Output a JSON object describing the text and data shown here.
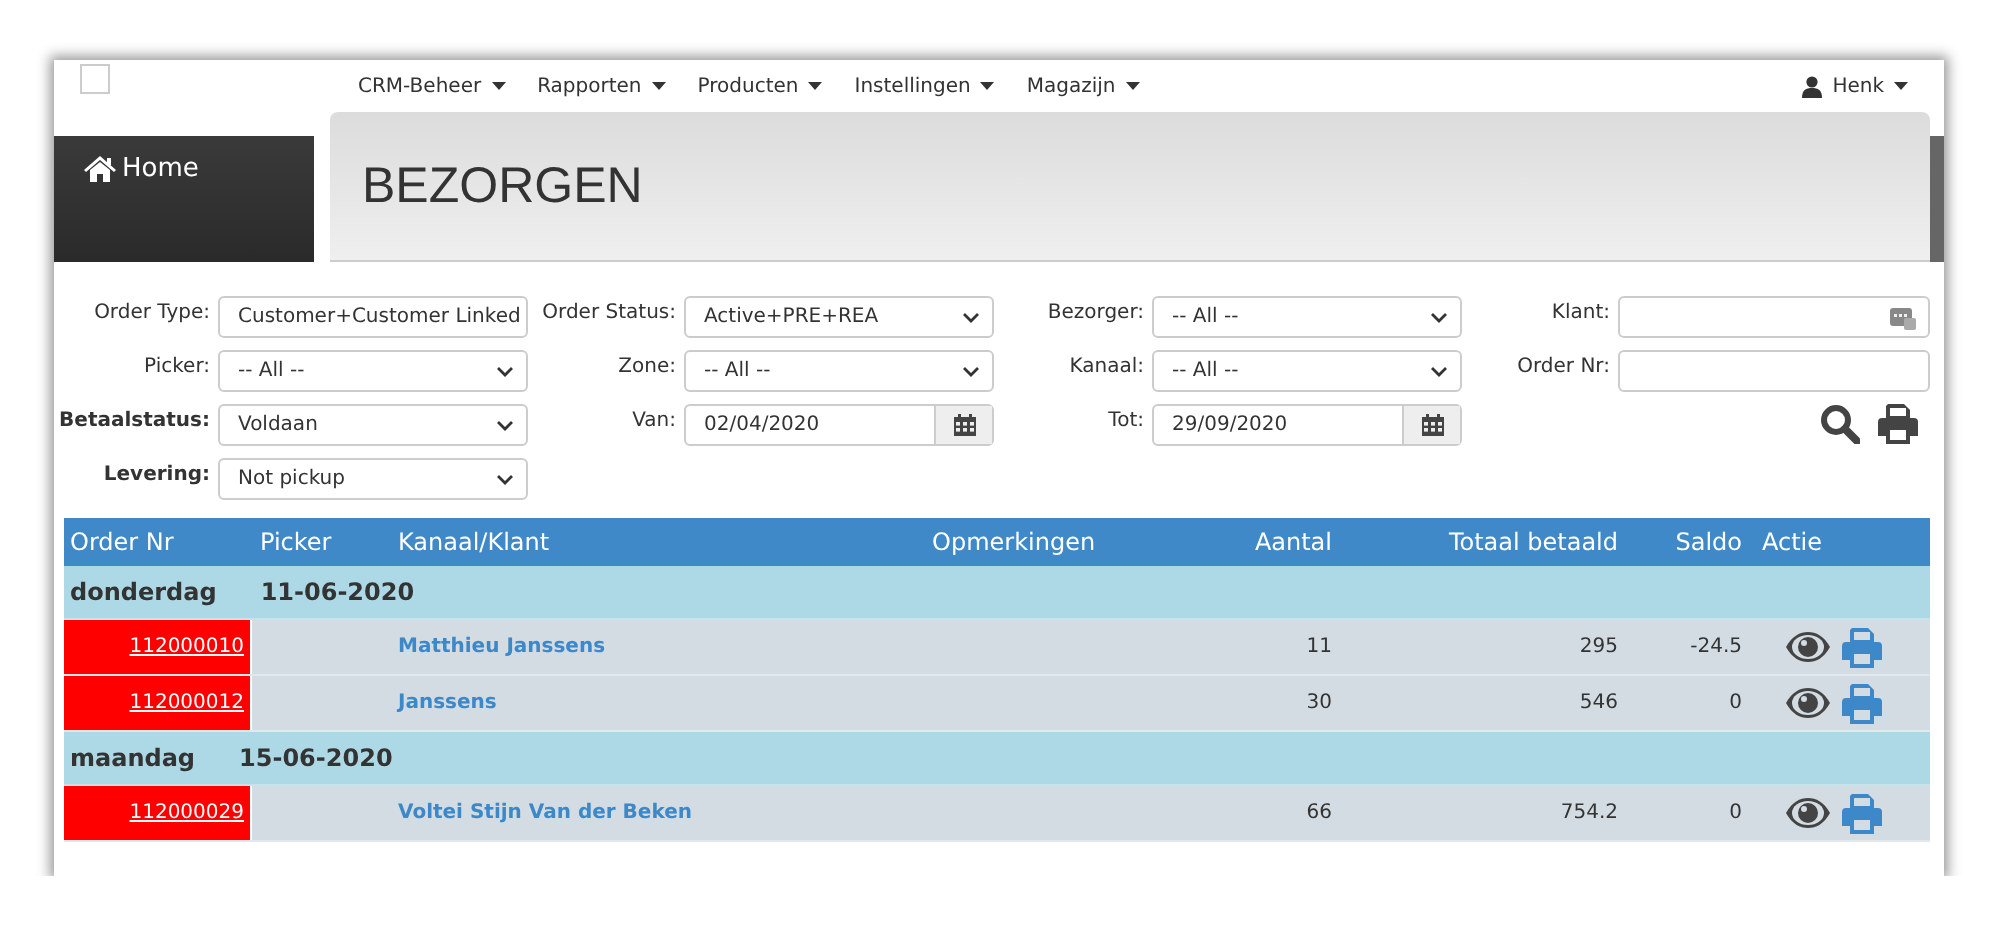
{
  "navbar": {
    "menus": [
      {
        "label": "CRM-Beheer"
      },
      {
        "label": "Rapporten"
      },
      {
        "label": "Producten"
      },
      {
        "label": "Instellingen"
      },
      {
        "label": "Magazijn"
      }
    ],
    "user": "Henk"
  },
  "sidebar": {
    "items": [
      {
        "label": "Home",
        "selected": true
      }
    ]
  },
  "page_title": "BEZORGEN",
  "filters": {
    "rows": [
      [
        {
          "kind": "select",
          "label": "Order Type:",
          "value": "Customer+Customer Linked",
          "emphasized": false
        },
        {
          "kind": "select",
          "label": "Order Status:",
          "value": "Active+PRE+REA",
          "emphasized": false
        },
        {
          "kind": "select",
          "label": "Bezorger:",
          "value": "-- All --",
          "emphasized": false
        },
        {
          "kind": "lookup",
          "label": "Klant:",
          "emphasized": false
        }
      ],
      [
        {
          "kind": "select",
          "label": "Picker:",
          "value": "-- All --",
          "emphasized": false
        },
        {
          "kind": "select",
          "label": "Zone:",
          "value": "-- All --",
          "emphasized": false
        },
        {
          "kind": "select",
          "label": "Kanaal:",
          "value": "-- All --",
          "emphasized": false
        },
        {
          "kind": "text",
          "label": "Order Nr:",
          "emphasized": false
        }
      ],
      [
        {
          "kind": "select",
          "label": "Betaalstatus:",
          "value": "Voldaan",
          "emphasized": true
        },
        {
          "kind": "date",
          "label": "Van:",
          "value": "02/04/2020",
          "emphasized": false
        },
        {
          "kind": "date",
          "label": "Tot:",
          "value": "29/09/2020",
          "emphasized": false
        },
        {
          "kind": "actions"
        }
      ],
      [
        {
          "kind": "select",
          "label": "Levering:",
          "value": "Not pickup",
          "emphasized": true
        }
      ]
    ]
  },
  "table": {
    "columns": [
      "Order Nr",
      "Picker",
      "Kanaal/Klant",
      "Opmerkingen",
      "Aantal",
      "Totaal betaald",
      "Saldo",
      "Actie"
    ],
    "groups": [
      {
        "day": "donderdag",
        "date": "11-06-2020",
        "rows": [
          {
            "order_nr": "112000010",
            "klant": "Matthieu Janssens",
            "aantal": "11",
            "totaal": "295",
            "saldo": "-24.5"
          },
          {
            "order_nr": "112000012",
            "klant": "Janssens",
            "aantal": "30",
            "totaal": "546",
            "saldo": "0"
          }
        ]
      },
      {
        "day": "maandag",
        "date": "15-06-2020",
        "rows": [
          {
            "order_nr": "112000029",
            "klant": "Voltei Stijn Van der Beken",
            "aantal": "66",
            "totaal": "754.2",
            "saldo": "0"
          }
        ]
      }
    ]
  }
}
